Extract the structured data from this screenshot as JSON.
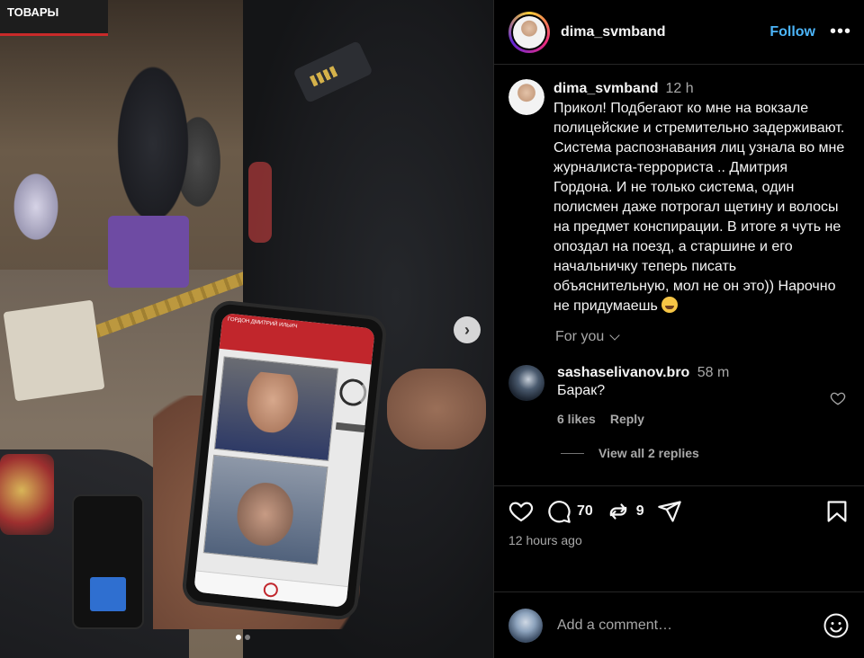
{
  "post": {
    "author": "dima_svmband",
    "follow_label": "Follow",
    "more_label": "•••",
    "caption_time": "12 h",
    "caption_text": "Прикол! Подбегают ко мне на вокзале полицейские и стремительно задерживают. Система распознавания лиц узнала во мне журналиста-террориста .. Дмитрия Гордона. И не только система, один полисмен даже потрогал щетину и волосы на предмет конспирации. В итоге я чуть не опоздал на поезд, а старшине и его начальничку теперь писать объяснительную, мол не он это)) Нарочно не придумаешь",
    "caption_emoji": "grinning-squinting-face-emoji",
    "for_you_label": "For you"
  },
  "comment": {
    "user": "sashaselivanov.bro",
    "time": "58 m",
    "text": "Барак?",
    "likes": "6 likes",
    "reply_label": "Reply",
    "view_replies": "View all 2 replies"
  },
  "actions": {
    "comments_count": "70",
    "reposts_count": "9",
    "time_ago": "12 hours ago",
    "icons": [
      "heart-icon",
      "comment-icon",
      "repost-icon",
      "share-icon",
      "bookmark-icon"
    ]
  },
  "add_comment": {
    "placeholder": "Add a comment…"
  },
  "media": {
    "next_arrow": "›",
    "slide_count": 2,
    "active_slide": 1,
    "phone_header": "ГОРДОН ДМИТРИЙ ИЛЬИЧ",
    "sign_text": "ТОВАРЫ"
  },
  "colors": {
    "follow": "#4cb5f9",
    "muted": "#a8a8a8",
    "background": "#000000",
    "divider": "#262626"
  }
}
